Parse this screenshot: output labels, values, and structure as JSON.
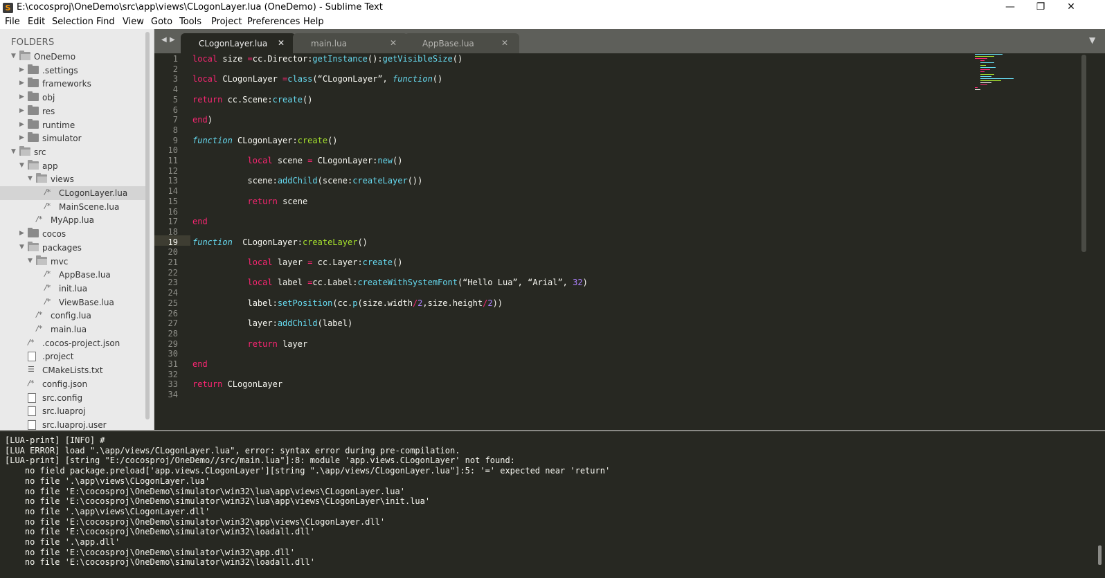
{
  "window": {
    "title": "E:\\cocosproj\\OneDemo\\src\\app\\views\\CLogonLayer.lua (OneDemo) - Sublime Text",
    "icon_name": "sublime-text-icon",
    "minimize": "—",
    "maximize": "❐",
    "close": "✕"
  },
  "menu": [
    "File",
    "Edit",
    "Selection",
    "Find",
    "View",
    "Goto",
    "Tools",
    "Project",
    "Preferences",
    "Help"
  ],
  "sidebar": {
    "title": "FOLDERS",
    "items": [
      {
        "label": "OneDemo",
        "icon": "folder-open-icon",
        "arrow": "▼"
      },
      {
        "label": ".settings",
        "icon": "folder-icon",
        "arrow": "▶"
      },
      {
        "label": "frameworks",
        "icon": "folder-icon",
        "arrow": "▶"
      },
      {
        "label": "obj",
        "icon": "folder-icon",
        "arrow": "▶"
      },
      {
        "label": "res",
        "icon": "folder-icon",
        "arrow": "▶"
      },
      {
        "label": "runtime",
        "icon": "folder-icon",
        "arrow": "▶"
      },
      {
        "label": "simulator",
        "icon": "folder-icon",
        "arrow": "▶"
      },
      {
        "label": "src",
        "icon": "folder-open-icon",
        "arrow": "▼"
      },
      {
        "label": "app",
        "icon": "folder-open-icon",
        "arrow": "▼"
      },
      {
        "label": "views",
        "icon": "folder-open-icon",
        "arrow": "▼"
      },
      {
        "label": "CLogonLayer.lua",
        "icon": "lua-file-icon",
        "glyph": "/*",
        "selected": true
      },
      {
        "label": "MainScene.lua",
        "icon": "lua-file-icon",
        "glyph": "/*"
      },
      {
        "label": "MyApp.lua",
        "icon": "lua-file-icon",
        "glyph": "/*"
      },
      {
        "label": "cocos",
        "icon": "folder-icon",
        "arrow": "▶"
      },
      {
        "label": "packages",
        "icon": "folder-open-icon",
        "arrow": "▼"
      },
      {
        "label": "mvc",
        "icon": "folder-open-icon",
        "arrow": "▼"
      },
      {
        "label": "AppBase.lua",
        "icon": "lua-file-icon",
        "glyph": "/*"
      },
      {
        "label": "init.lua",
        "icon": "lua-file-icon",
        "glyph": "/*"
      },
      {
        "label": "ViewBase.lua",
        "icon": "lua-file-icon",
        "glyph": "/*"
      },
      {
        "label": "config.lua",
        "icon": "lua-file-icon",
        "glyph": "/*"
      },
      {
        "label": "main.lua",
        "icon": "lua-file-icon",
        "glyph": "/*"
      },
      {
        "label": ".cocos-project.json",
        "icon": "json-file-icon",
        "glyph": "/*"
      },
      {
        "label": ".project",
        "icon": "document-icon"
      },
      {
        "label": "CMakeLists.txt",
        "icon": "text-lines-icon",
        "glyph": "☰"
      },
      {
        "label": "config.json",
        "icon": "json-file-icon",
        "glyph": "/*"
      },
      {
        "label": "src.config",
        "icon": "document-icon"
      },
      {
        "label": "src.luaproj",
        "icon": "document-icon"
      },
      {
        "label": "src.luaproj.user",
        "icon": "document-icon"
      }
    ]
  },
  "editor": {
    "tabs": [
      {
        "label": "CLogonLayer.lua",
        "active": true,
        "close": "✕"
      },
      {
        "label": "main.lua",
        "active": false,
        "close": "✕"
      },
      {
        "label": "AppBase.lua",
        "active": false,
        "close": "✕"
      }
    ],
    "nav_left": "◀",
    "nav_right": "▶",
    "tab_menu": "▼",
    "current_line": "19",
    "line_numbers": [
      "1",
      "2",
      "3",
      "4",
      "5",
      "6",
      "7",
      "8",
      "9",
      "10",
      "11",
      "12",
      "13",
      "14",
      "15",
      "16",
      "17",
      "18",
      "19",
      "20",
      "21",
      "22",
      "23",
      "24",
      "25",
      "26",
      "27",
      "28",
      "29",
      "30",
      "31",
      "32",
      "33",
      "34"
    ],
    "code_lines": [
      [
        {
          "t": "local",
          "c": "kw"
        },
        {
          "t": " size ",
          "c": ""
        },
        {
          "t": "=",
          "c": "kw"
        },
        {
          "t": "cc.Director:",
          "c": ""
        },
        {
          "t": "getInstance",
          "c": "bi"
        },
        {
          "t": "():",
          "c": ""
        },
        {
          "t": "getVisibleSize",
          "c": "bi"
        },
        {
          "t": "()",
          "c": ""
        }
      ],
      [],
      [
        {
          "t": "local",
          "c": "kw"
        },
        {
          "t": " CLogonLayer ",
          "c": ""
        },
        {
          "t": "=",
          "c": "kw"
        },
        {
          "t": "class",
          "c": "bi"
        },
        {
          "t": "(“CLogonLayer”, ",
          "c": ""
        },
        {
          "t": "function",
          "c": "it"
        },
        {
          "t": "()",
          "c": ""
        }
      ],
      [],
      [
        {
          "t": "return",
          "c": "kw"
        },
        {
          "t": " cc.Scene:",
          "c": ""
        },
        {
          "t": "create",
          "c": "bi"
        },
        {
          "t": "()",
          "c": ""
        }
      ],
      [],
      [
        {
          "t": "end",
          "c": "kw"
        },
        {
          "t": ")",
          "c": ""
        }
      ],
      [],
      [
        {
          "t": "function",
          "c": "it"
        },
        {
          "t": " CLogonLayer:",
          "c": ""
        },
        {
          "t": "create",
          "c": "fn"
        },
        {
          "t": "()",
          "c": ""
        }
      ],
      [],
      [
        {
          "t": "           ",
          "c": ""
        },
        {
          "t": "local",
          "c": "kw"
        },
        {
          "t": " scene ",
          "c": ""
        },
        {
          "t": "=",
          "c": "kw"
        },
        {
          "t": " CLogonLayer:",
          "c": ""
        },
        {
          "t": "new",
          "c": "bi"
        },
        {
          "t": "()",
          "c": ""
        }
      ],
      [],
      [
        {
          "t": "           scene:",
          "c": ""
        },
        {
          "t": "addChild",
          "c": "bi"
        },
        {
          "t": "(scene:",
          "c": ""
        },
        {
          "t": "createLayer",
          "c": "bi"
        },
        {
          "t": "())",
          "c": ""
        }
      ],
      [],
      [
        {
          "t": "           ",
          "c": ""
        },
        {
          "t": "return",
          "c": "kw"
        },
        {
          "t": " scene",
          "c": ""
        }
      ],
      [],
      [
        {
          "t": "end",
          "c": "kw"
        }
      ],
      [],
      [
        {
          "t": "function",
          "c": "it"
        },
        {
          "t": "  CLogonLayer:",
          "c": ""
        },
        {
          "t": "createLayer",
          "c": "fn"
        },
        {
          "t": "()",
          "c": ""
        }
      ],
      [],
      [
        {
          "t": "           ",
          "c": ""
        },
        {
          "t": "local",
          "c": "kw"
        },
        {
          "t": " layer ",
          "c": ""
        },
        {
          "t": "=",
          "c": "kw"
        },
        {
          "t": " cc.Layer:",
          "c": ""
        },
        {
          "t": "create",
          "c": "bi"
        },
        {
          "t": "()",
          "c": ""
        }
      ],
      [],
      [
        {
          "t": "           ",
          "c": ""
        },
        {
          "t": "local",
          "c": "kw"
        },
        {
          "t": " label ",
          "c": ""
        },
        {
          "t": "=",
          "c": "kw"
        },
        {
          "t": "cc.Label:",
          "c": ""
        },
        {
          "t": "createWithSystemFont",
          "c": "bi"
        },
        {
          "t": "(“Hello Lua”, “Arial”, ",
          "c": ""
        },
        {
          "t": "32",
          "c": "num"
        },
        {
          "t": ")",
          "c": ""
        }
      ],
      [],
      [
        {
          "t": "           label:",
          "c": ""
        },
        {
          "t": "setPosition",
          "c": "bi"
        },
        {
          "t": "(cc.",
          "c": ""
        },
        {
          "t": "p",
          "c": "bi"
        },
        {
          "t": "(size.width",
          "c": ""
        },
        {
          "t": "/",
          "c": "kw"
        },
        {
          "t": "2",
          "c": "num"
        },
        {
          "t": ",size.height",
          "c": ""
        },
        {
          "t": "/",
          "c": "kw"
        },
        {
          "t": "2",
          "c": "num"
        },
        {
          "t": "))",
          "c": ""
        }
      ],
      [],
      [
        {
          "t": "           layer:",
          "c": ""
        },
        {
          "t": "addChild",
          "c": "bi"
        },
        {
          "t": "(label)",
          "c": ""
        }
      ],
      [],
      [
        {
          "t": "           ",
          "c": ""
        },
        {
          "t": "return",
          "c": "kw"
        },
        {
          "t": " layer",
          "c": ""
        }
      ],
      [],
      [
        {
          "t": "end",
          "c": "kw"
        }
      ],
      [],
      [
        {
          "t": "return",
          "c": "kw"
        },
        {
          "t": " CLogonLayer",
          "c": ""
        }
      ],
      []
    ]
  },
  "console": {
    "lines": [
      "[LUA-print] [INFO] #",
      "[LUA ERROR] load \".\\app/views/CLogonLayer.lua\", error: syntax error during pre-compilation.",
      "[LUA-print] [string \"E:/cocosproj/OneDemo//src/main.lua\"]:8: module 'app.views.CLogonLayer' not found:",
      "    no field package.preload['app.views.CLogonLayer'][string \".\\app/views/CLogonLayer.lua\"]:5: '=' expected near 'return'",
      "    no file '.\\app\\views\\CLogonLayer.lua'",
      "    no file 'E:\\cocosproj\\OneDemo\\simulator\\win32\\lua\\app\\views\\CLogonLayer.lua'",
      "    no file 'E:\\cocosproj\\OneDemo\\simulator\\win32\\lua\\app\\views\\CLogonLayer\\init.lua'",
      "    no file '.\\app\\views\\CLogonLayer.dll'",
      "    no file 'E:\\cocosproj\\OneDemo\\simulator\\win32\\app\\views\\CLogonLayer.dll'",
      "    no file 'E:\\cocosproj\\OneDemo\\simulator\\win32\\loadall.dll'",
      "    no file '.\\app.dll'",
      "    no file 'E:\\cocosproj\\OneDemo\\simulator\\win32\\app.dll'",
      "    no file 'E:\\cocosproj\\OneDemo\\simulator\\win32\\loadall.dll'"
    ]
  },
  "colors": {
    "editor_bg": "#272822",
    "keyword": "#f92672",
    "function_name": "#a6e22e",
    "builtin": "#66d9ef",
    "number": "#ae81ff",
    "text": "#f8f8f2"
  }
}
